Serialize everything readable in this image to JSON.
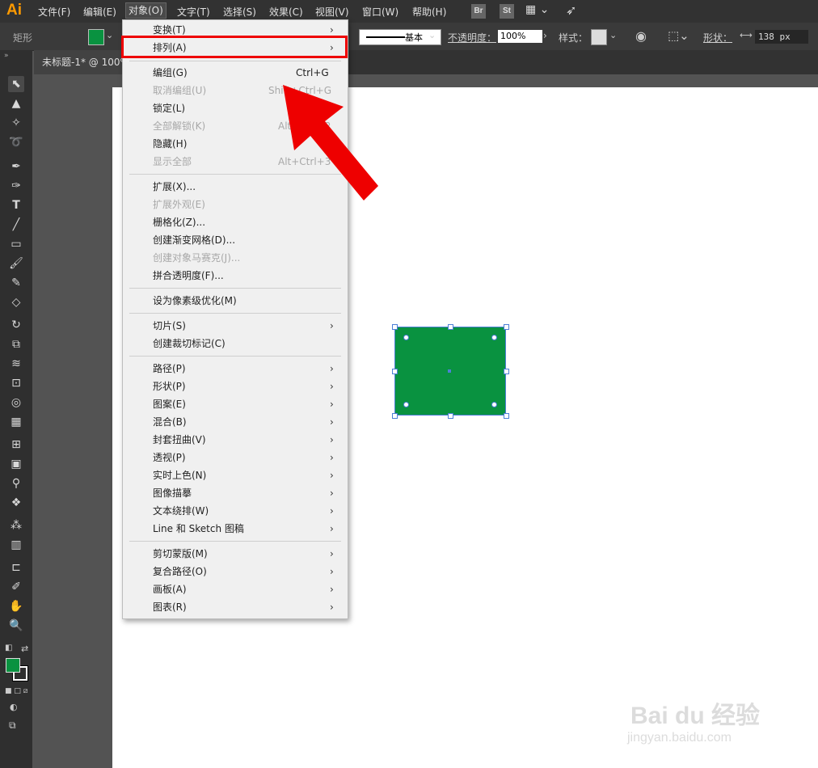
{
  "app": {
    "logo": "Ai"
  },
  "menubar": {
    "items": [
      {
        "label": "文件(F)"
      },
      {
        "label": "编辑(E)"
      },
      {
        "label": "对象(O)"
      },
      {
        "label": "文字(T)"
      },
      {
        "label": "选择(S)"
      },
      {
        "label": "效果(C)"
      },
      {
        "label": "视图(V)"
      },
      {
        "label": "窗口(W)"
      },
      {
        "label": "帮助(H)"
      }
    ],
    "bridge_label": "Br",
    "stock_label": "St"
  },
  "control_bar": {
    "object_type": "矩形",
    "stroke_style": "基本",
    "opacity_label": "不透明度：",
    "opacity_value": "100%",
    "style_label": "样式：",
    "shape_label": "形状：",
    "width_value": "138 px"
  },
  "document_tab": {
    "title": "未标题-1* @ 100%"
  },
  "colors": {
    "fill": "#099240",
    "highlight": "#ee0000",
    "arrow": "#ee0000"
  },
  "object_menu": {
    "items": [
      {
        "label": "变换(T)",
        "submenu": true
      },
      {
        "label": "排列(A)",
        "submenu": true,
        "highlighted": true
      },
      {
        "label": "编组(G)",
        "shortcut": "Ctrl+G"
      },
      {
        "label": "取消编组(U)",
        "shortcut": "Shift+Ctrl+G",
        "disabled": true
      },
      {
        "label": "锁定(L)",
        "submenu": true
      },
      {
        "label": "全部解锁(K)",
        "shortcut": "Alt+Ctrl+2",
        "disabled": true
      },
      {
        "label": "隐藏(H)",
        "submenu": true
      },
      {
        "label": "显示全部",
        "shortcut": "Alt+Ctrl+3",
        "disabled": true
      },
      {
        "label": "扩展(X)..."
      },
      {
        "label": "扩展外观(E)",
        "disabled": true
      },
      {
        "label": "栅格化(Z)..."
      },
      {
        "label": "创建渐变网格(D)..."
      },
      {
        "label": "创建对象马赛克(J)...",
        "disabled": true
      },
      {
        "label": "拼合透明度(F)..."
      },
      {
        "label": "设为像素级优化(M)"
      },
      {
        "label": "切片(S)",
        "submenu": true
      },
      {
        "label": "创建裁切标记(C)"
      },
      {
        "label": "路径(P)",
        "submenu": true
      },
      {
        "label": "形状(P)",
        "submenu": true
      },
      {
        "label": "图案(E)",
        "submenu": true
      },
      {
        "label": "混合(B)",
        "submenu": true
      },
      {
        "label": "封套扭曲(V)",
        "submenu": true
      },
      {
        "label": "透视(P)",
        "submenu": true
      },
      {
        "label": "实时上色(N)",
        "submenu": true
      },
      {
        "label": "图像描摹",
        "submenu": true
      },
      {
        "label": "文本绕排(W)",
        "submenu": true
      },
      {
        "label": "Line 和 Sketch 图稿",
        "submenu": true
      },
      {
        "label": "剪切蒙版(M)",
        "submenu": true
      },
      {
        "label": "复合路径(O)",
        "submenu": true
      },
      {
        "label": "画板(A)",
        "submenu": true
      },
      {
        "label": "图表(R)",
        "submenu": true
      }
    ],
    "arrow_glyph": "›"
  },
  "watermark": {
    "brand": "Bai du 经验",
    "url": "jingyan.baidu.com"
  }
}
